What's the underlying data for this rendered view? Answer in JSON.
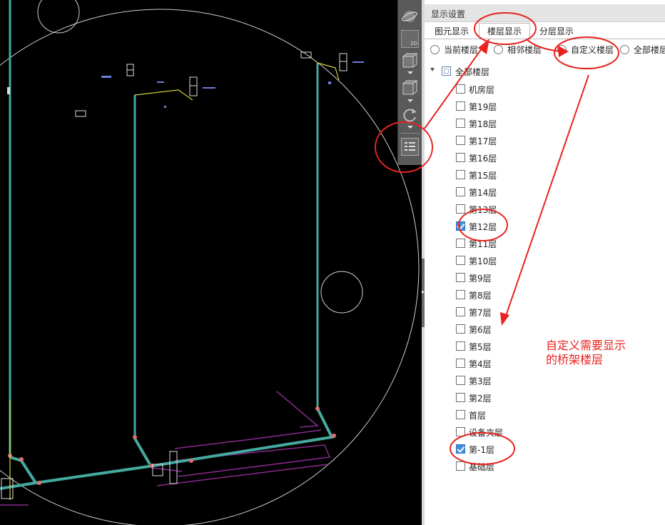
{
  "panel": {
    "title": "显示设置",
    "tabs": [
      {
        "label": "图元显示",
        "active": false
      },
      {
        "label": "楼层显示",
        "active": true
      },
      {
        "label": "分层显示",
        "active": false
      }
    ],
    "radios": [
      {
        "label": "当前楼层",
        "selected": false
      },
      {
        "label": "相邻楼层",
        "selected": false
      },
      {
        "label": "自定义楼层",
        "selected": true
      },
      {
        "label": "全部楼层",
        "selected": false
      }
    ],
    "tree_root": "全部楼层",
    "floors": [
      {
        "label": "机房层",
        "checked": false
      },
      {
        "label": "第19层",
        "checked": false
      },
      {
        "label": "第18层",
        "checked": false
      },
      {
        "label": "第17层",
        "checked": false
      },
      {
        "label": "第16层",
        "checked": false
      },
      {
        "label": "第15层",
        "checked": false
      },
      {
        "label": "第14层",
        "checked": false
      },
      {
        "label": "第13层",
        "checked": false
      },
      {
        "label": "第12层",
        "checked": true
      },
      {
        "label": "第11层",
        "checked": false
      },
      {
        "label": "第10层",
        "checked": false
      },
      {
        "label": "第9层",
        "checked": false
      },
      {
        "label": "第8层",
        "checked": false
      },
      {
        "label": "第7层",
        "checked": false
      },
      {
        "label": "第6层",
        "checked": false
      },
      {
        "label": "第5层",
        "checked": false
      },
      {
        "label": "第4层",
        "checked": false
      },
      {
        "label": "第3层",
        "checked": false
      },
      {
        "label": "第2层",
        "checked": false
      },
      {
        "label": "首层",
        "checked": false
      },
      {
        "label": "设备夹层",
        "checked": false
      },
      {
        "label": "第-1层",
        "checked": true
      },
      {
        "label": "基础层",
        "checked": false
      }
    ]
  },
  "toolbar": {
    "view_2d_label": "2D",
    "icons": [
      "orbit-icon",
      "view-2d-icon",
      "view-3d-box-icon",
      "view-box-icon",
      "rotate-icon",
      "floor-display-icon"
    ]
  },
  "annotation": {
    "line1": "自定义需要显示",
    "line2": "的桥架楼层",
    "color": "#e8231f"
  },
  "colors": {
    "pipe": "#45a9a0",
    "purple": "#8a2a8f",
    "highlight": "#3f8ce0"
  }
}
